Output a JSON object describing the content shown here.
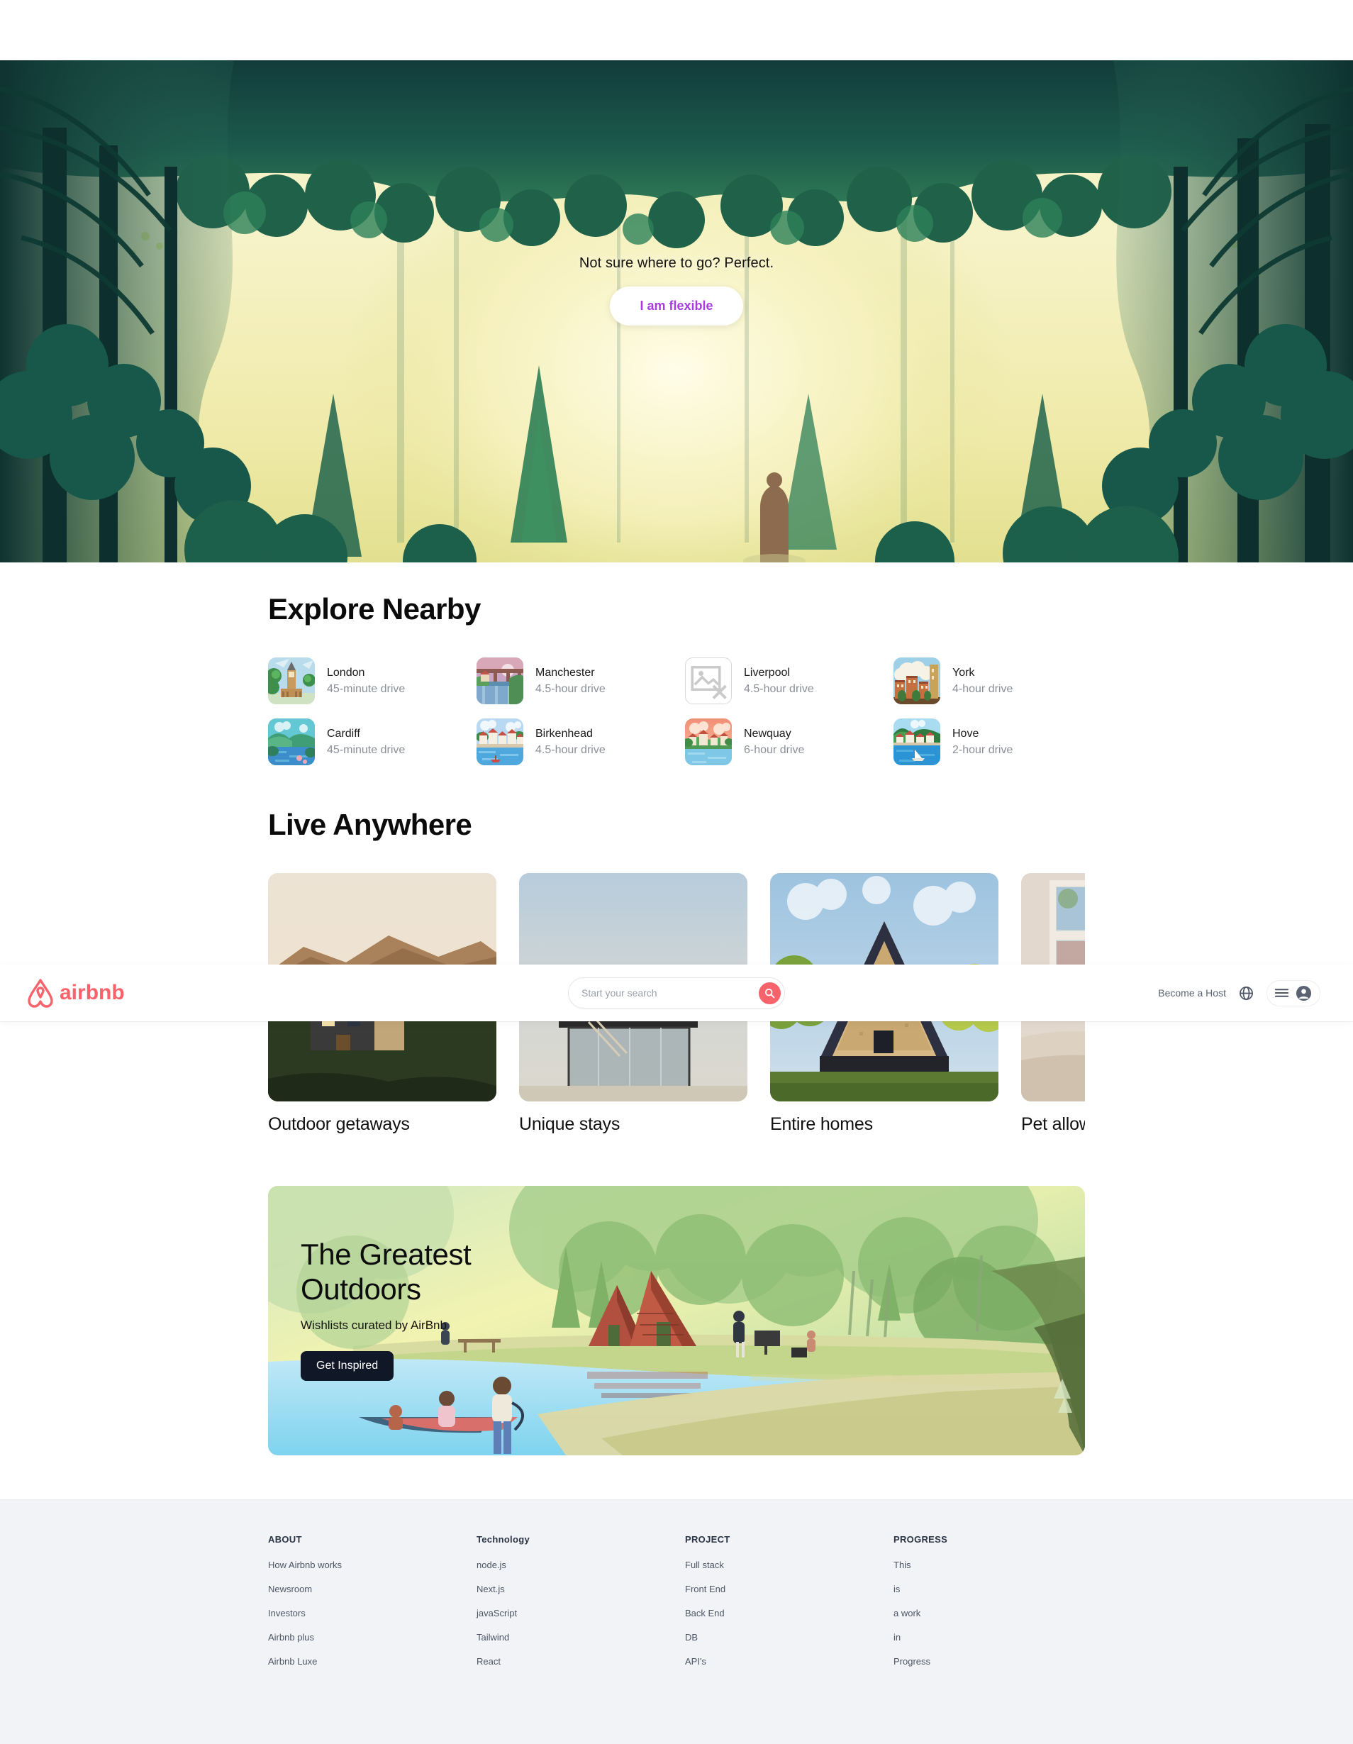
{
  "brand": {
    "name": "airbnb",
    "logo_icon": "airbnb-belo-logo",
    "accent": "#f8636b"
  },
  "navbar": {
    "search": {
      "placeholder": "Start your search",
      "value": "",
      "icon": "search-icon"
    },
    "become_host_label": "Become a Host",
    "globe_icon": "globe-icon",
    "menu_icon": "hamburger-menu-icon",
    "avatar_icon": "user-avatar-icon"
  },
  "hero": {
    "tagline": "Not sure where to go? Perfect.",
    "cta_label": "I am flexible",
    "cta_color": "#a83ce0",
    "background": "forest-sunbeam-illustration"
  },
  "explore": {
    "title": "Explore Nearby",
    "cities": [
      {
        "name": "London",
        "drive": "45-minute drive",
        "icon": "big-ben-thumbnail",
        "broken": false
      },
      {
        "name": "Manchester",
        "drive": "4.5-hour drive",
        "icon": "viaduct-bridge-thumbnail",
        "broken": false
      },
      {
        "name": "Liverpool",
        "drive": "4.5-hour drive",
        "icon": "broken-image-icon",
        "broken": true
      },
      {
        "name": "York",
        "drive": "4-hour drive",
        "icon": "old-town-thumbnail",
        "broken": false
      },
      {
        "name": "Cardiff",
        "drive": "45-minute drive",
        "icon": "lake-hills-thumbnail",
        "broken": false
      },
      {
        "name": "Birkenhead",
        "drive": "4.5-hour drive",
        "icon": "harbour-town-thumbnail",
        "broken": false
      },
      {
        "name": "Newquay",
        "drive": "6-hour drive",
        "icon": "sunset-village-thumbnail",
        "broken": false
      },
      {
        "name": "Hove",
        "drive": "2-hour drive",
        "icon": "coastal-bay-thumbnail",
        "broken": false
      }
    ]
  },
  "live_anywhere": {
    "title": "Live Anywhere",
    "cards": [
      {
        "label": "Outdoor getaways",
        "image": "cabin-in-mountains-photo"
      },
      {
        "label": "Unique stays",
        "image": "modern-rooftop-house-photo"
      },
      {
        "label": "Entire homes",
        "image": "a-frame-timber-house-photo"
      },
      {
        "label": "Pet allowed",
        "image": "dog-by-window-photo"
      }
    ]
  },
  "banner": {
    "title_line1": "The Greatest",
    "title_line2": "Outdoors",
    "subtitle": "Wishlists curated by AirBnb",
    "cta_label": "Get Inspired",
    "cta_bg": "#101727",
    "background": "lakeside-cabins-illustration"
  },
  "footer": {
    "columns": [
      {
        "head": "ABOUT",
        "links": [
          "How Airbnb works",
          "Newsroom",
          "Investors",
          "Airbnb plus",
          "Airbnb Luxe"
        ]
      },
      {
        "head": "Technology",
        "links": [
          "node.js",
          "Next.js",
          "javaScript",
          "Tailwind",
          "React"
        ]
      },
      {
        "head": "PROJECT",
        "links": [
          "Full stack",
          "Front End",
          "Back End",
          "DB",
          "API's"
        ]
      },
      {
        "head": "PROGRESS",
        "links": [
          "This",
          "is",
          "a work",
          "in",
          "Progress"
        ]
      }
    ]
  }
}
